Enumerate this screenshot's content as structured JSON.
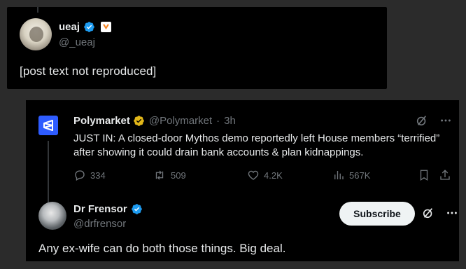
{
  "top_post": {
    "author_name": "ueaj",
    "author_handle": "@_ueaj",
    "body": "[post text not reproduced]"
  },
  "quoted_post": {
    "author_name": "Polymarket",
    "author_handle": "@Polymarket",
    "time": "3h",
    "separator": "·",
    "body": "JUST IN: A closed-door Mythos demo reportedly left House members “terrified” after showing it could drain bank accounts & plan kidnappings.",
    "stats": {
      "replies": "334",
      "reposts": "509",
      "likes": "4.2K",
      "views": "567K"
    }
  },
  "reply_post": {
    "author_name": "Dr Frensor",
    "author_handle": "@drfrensor",
    "subscribe_label": "Subscribe",
    "body": "Any ex-wife can do both those things. Big deal."
  },
  "colors": {
    "background": "#000000",
    "frame": "#2b2b2b",
    "text": "#e7e9ea",
    "muted": "#71767b",
    "verified_blue": "#1d9bf0",
    "gold": "#e2b719",
    "polymarket_blue": "#2e5cff"
  },
  "icons": [
    "verified-icon",
    "gold-verified-icon",
    "grok-icon",
    "more-icon",
    "reply-icon",
    "repost-icon",
    "like-icon",
    "views-icon",
    "bookmark-icon",
    "share-icon"
  ]
}
